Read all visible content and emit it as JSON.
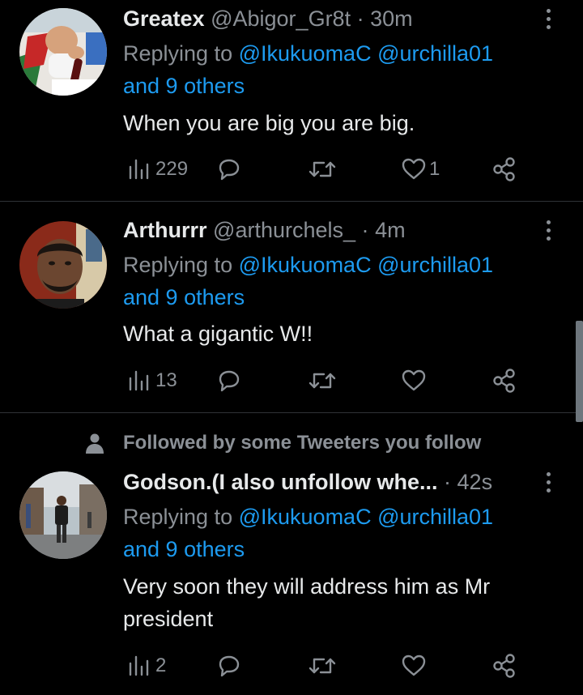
{
  "tweets": [
    {
      "name": "Greatex",
      "handle": "@Abigor_Gr8t",
      "separator": "·",
      "time": "30m",
      "replying_prefix": "Replying to",
      "replying_user1": "@IkukuomaC",
      "replying_user2": "@urchilla01",
      "replying_others": "and 9 others",
      "text": "When you are big you are big.",
      "views": "229",
      "likes": "1"
    },
    {
      "name": "Arthurrr",
      "handle": "@arthurchels_",
      "separator": "·",
      "time": "4m",
      "replying_prefix": "Replying to",
      "replying_user1": "@IkukuomaC",
      "replying_user2": "@urchilla01",
      "replying_others": "and 9 others",
      "text": "What a gigantic W!!",
      "views": "13",
      "likes": ""
    },
    {
      "name": "Godson.(I also unfollow whe...",
      "handle": "",
      "separator": "·",
      "time": "42s",
      "replying_prefix": "Replying to",
      "replying_user1": "@IkukuomaC",
      "replying_user2": "@urchilla01",
      "replying_others": "and 9 others",
      "text": "Very soon they will address him as Mr president",
      "views": "2",
      "likes": ""
    }
  ],
  "social_context": "Followed by some Tweeters you follow",
  "colors": {
    "link": "#1d9bf0",
    "muted": "#8b9096",
    "text": "#e7e9ea",
    "background": "#000000"
  }
}
